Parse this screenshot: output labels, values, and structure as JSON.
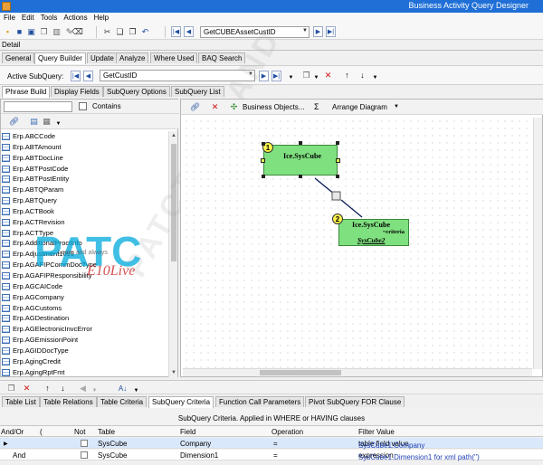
{
  "window": {
    "title": "Business Activity Query Designer"
  },
  "menu": [
    "File",
    "Edit",
    "Tools",
    "Actions",
    "Help"
  ],
  "toolbar": {
    "query_id": "GetCUBEAssetCustID"
  },
  "detail_label": "Detail",
  "main_tabs": [
    "General",
    "Query Builder",
    "Update",
    "Analyze",
    "Where Used",
    "BAQ Search"
  ],
  "main_tab_active": 1,
  "subquery": {
    "label": "Active SubQuery:",
    "value": "GetCustID"
  },
  "sub_tabs": [
    "Phrase Build",
    "Display Fields",
    "SubQuery Options",
    "SubQuery List"
  ],
  "left_pane": {
    "search_value": "",
    "contains_label": "Contains",
    "tables": [
      "Erp.ABCCode",
      "Erp.ABTAmount",
      "Erp.ABTDocLine",
      "Erp.ABTPostCode",
      "Erp.ABTPostEntity",
      "Erp.ABTQParam",
      "Erp.ABTQuery",
      "Erp.ACTBook",
      "Erp.ACTRevision",
      "Erp.ACTType",
      "Erp.AdditionalProctInfo",
      "Erp.Adjustment1099",
      "Erp.AGAFIPCommDocType",
      "Erp.AGAFIPResponsibility",
      "Erp.AGCAICode",
      "Erp.AGCompany",
      "Erp.AGCustoms",
      "Erp.AGDestination",
      "Erp.AGElectronicInvcError",
      "Erp.AGEmissionPoint",
      "Erp.AGIDDocType",
      "Erp.AgingCredit",
      "Erp.AgingRptFmt"
    ],
    "watermark": {
      "brand": "PATC",
      "tagline": "Learn and always",
      "script": "E10Live",
      "diag": "PATCTHAILAND"
    }
  },
  "right_pane": {
    "tools": {
      "business_objects": "Business Objects...",
      "sigma": "Σ",
      "arrange": "Arrange Diagram"
    },
    "diagram": {
      "nodes": [
        {
          "badge": "1",
          "name": "Ice.SysCube"
        },
        {
          "badge": "2",
          "name": "Ice.SysCube",
          "criteria": "~criteria",
          "link": "SysCube2"
        }
      ]
    }
  },
  "bottom_tabs": [
    "Table List",
    "Table Relations",
    "Table Criteria",
    "SubQuery Criteria",
    "Function Call Parameters",
    "Pivot SubQuery FOR Clause"
  ],
  "bottom_tab_active": 3,
  "criteria": {
    "title": "SubQuery Criteria. Applied in WHERE or HAVING clauses",
    "columns": [
      "And/Or",
      "(",
      "Not",
      "Table",
      "Field",
      "Operation",
      "Filter Value"
    ],
    "rows": [
      {
        "andor": "",
        "table": "SysCube",
        "field": "Company",
        "op": "=",
        "filter_link": "SysCube1.Company",
        "filter_rest": " table field value"
      },
      {
        "andor": "And",
        "table": "SysCube",
        "field": "Dimension1",
        "op": "=",
        "filter_link": "SysCube1.Dimension1 for xml path('')",
        "filter_rest": " expression"
      }
    ]
  },
  "colors": {
    "titlebar": "#1f6fd6",
    "node": "#7fe07f",
    "badge": "#fff44d",
    "selection": "#d9e8fb"
  }
}
